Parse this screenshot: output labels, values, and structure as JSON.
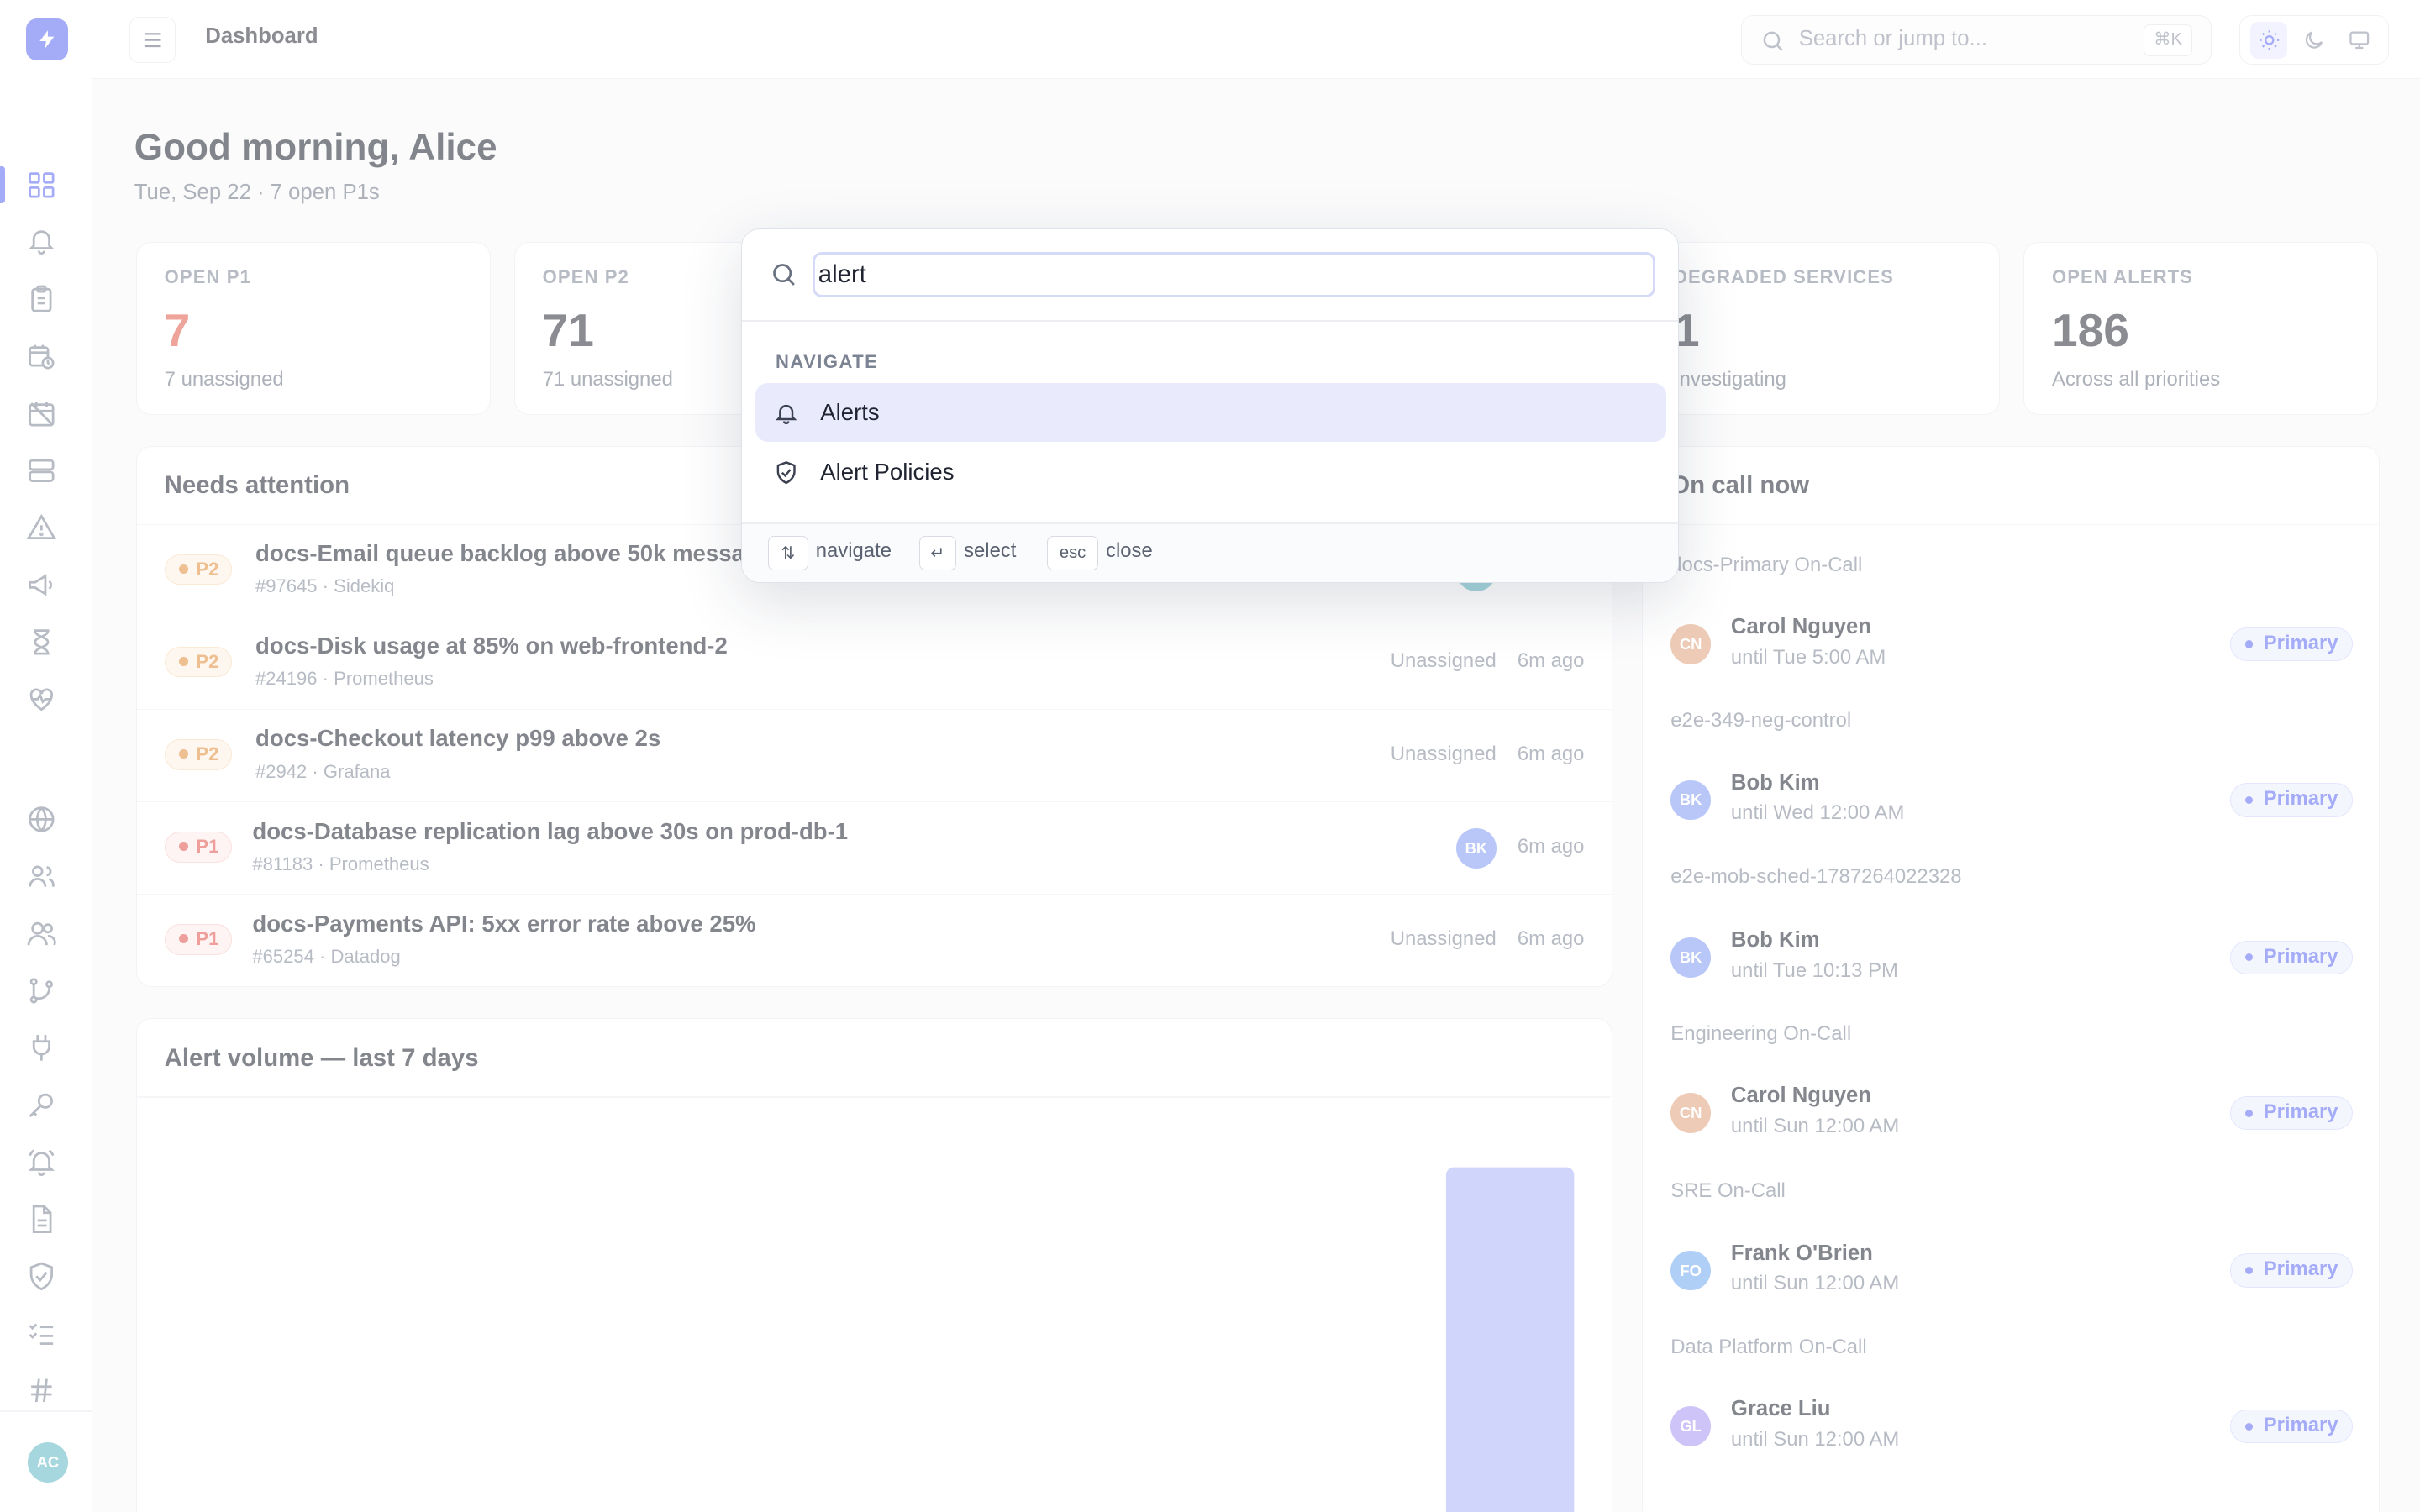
{
  "header": {
    "breadcrumb": "Dashboard",
    "search_placeholder": "Search or jump to...",
    "search_shortcut": "⌘K"
  },
  "greeting": {
    "title": "Good morning, Alice",
    "subtitle": "Tue, Sep 22 · 7 open P1s"
  },
  "stats": [
    {
      "label": "OPEN P1",
      "value": "7",
      "sub": "7 unassigned",
      "color": "#e05a48"
    },
    {
      "label": "OPEN P2",
      "value": "71",
      "sub": "71 unassigned"
    },
    {
      "label": "DEGRADED SERVICES",
      "value": "1",
      "sub": "Investigating"
    },
    {
      "label": "OPEN ALERTS",
      "value": "186",
      "sub": "Across all priorities"
    }
  ],
  "attention": {
    "title": "Needs attention",
    "rows": [
      {
        "priority": "P2",
        "title": "docs-Email queue backlog above 50k messages",
        "meta": "#97645 · Sidekiq",
        "assignee": "",
        "time": ""
      },
      {
        "priority": "P2",
        "title": "docs-Disk usage at 85% on web-frontend-2",
        "meta": "#24196 · Prometheus",
        "assignee": "Unassigned",
        "time": "6m ago"
      },
      {
        "priority": "P2",
        "title": "docs-Checkout latency p99 above 2s",
        "meta": "#2942 · Grafana",
        "assignee": "Unassigned",
        "time": "6m ago"
      },
      {
        "priority": "P1",
        "title": "docs-Database replication lag above 30s on prod-db-1",
        "meta": "#81183 · Prometheus",
        "avatar": "BK",
        "time": "6m ago"
      },
      {
        "priority": "P1",
        "title": "docs-Payments API: 5xx error rate above 25%",
        "meta": "#65254 · Datadog",
        "assignee": "Unassigned",
        "time": "6m ago"
      }
    ]
  },
  "volume": {
    "title": "Alert volume — last 7 days"
  },
  "chart_data": {
    "type": "bar",
    "title": "Alert volume — last 7 days",
    "categories": [
      "",
      "",
      "",
      "",
      "",
      "",
      ""
    ],
    "values": [
      0,
      0,
      0,
      0,
      0,
      0,
      186
    ],
    "ylim": [
      0,
      186
    ],
    "bar_color": "#aab2f9"
  },
  "oncall": {
    "title": "On call now",
    "groups": [
      {
        "schedule": "docs-Primary On-Call",
        "name": "Carol Nguyen",
        "initials": "CN",
        "until": "until Tue 5:00 AM",
        "role": "Primary",
        "color": "#e0a07a"
      },
      {
        "schedule": "e2e-349-neg-control",
        "name": "Bob Kim",
        "initials": "BK",
        "until": "until Wed 12:00 AM",
        "role": "Primary",
        "color": "#7f9af0"
      },
      {
        "schedule": "e2e-mob-sched-1787264022328",
        "name": "Bob Kim",
        "initials": "BK",
        "until": "until Tue 10:13 PM",
        "role": "Primary",
        "color": "#7f9af0"
      },
      {
        "schedule": "Engineering On-Call",
        "name": "Carol Nguyen",
        "initials": "CN",
        "until": "until Sun 12:00 AM",
        "role": "Primary",
        "color": "#e0a07a"
      },
      {
        "schedule": "SRE On-Call",
        "name": "Frank O'Brien",
        "initials": "FO",
        "until": "until Sun 12:00 AM",
        "role": "Primary",
        "color": "#6fa8f0"
      },
      {
        "schedule": "Data Platform On-Call",
        "name": "Grace Liu",
        "initials": "GL",
        "until": "until Sun 12:00 AM",
        "role": "Primary",
        "color": "#a894f0"
      }
    ]
  },
  "user": {
    "initials": "AC"
  },
  "palette": {
    "query": "alert",
    "section": "NAVIGATE",
    "items": [
      {
        "label": "Alerts",
        "icon": "bell-icon"
      },
      {
        "label": "Alert Policies",
        "icon": "shield-check-icon"
      }
    ],
    "hints": [
      {
        "key": "⇅",
        "label": "navigate"
      },
      {
        "key": "↵",
        "label": "select"
      },
      {
        "key": "esc",
        "label": "close"
      }
    ]
  },
  "colors": {
    "accent": "#5b68f0",
    "p1": "#e0504a",
    "p2": "#e08a35"
  }
}
